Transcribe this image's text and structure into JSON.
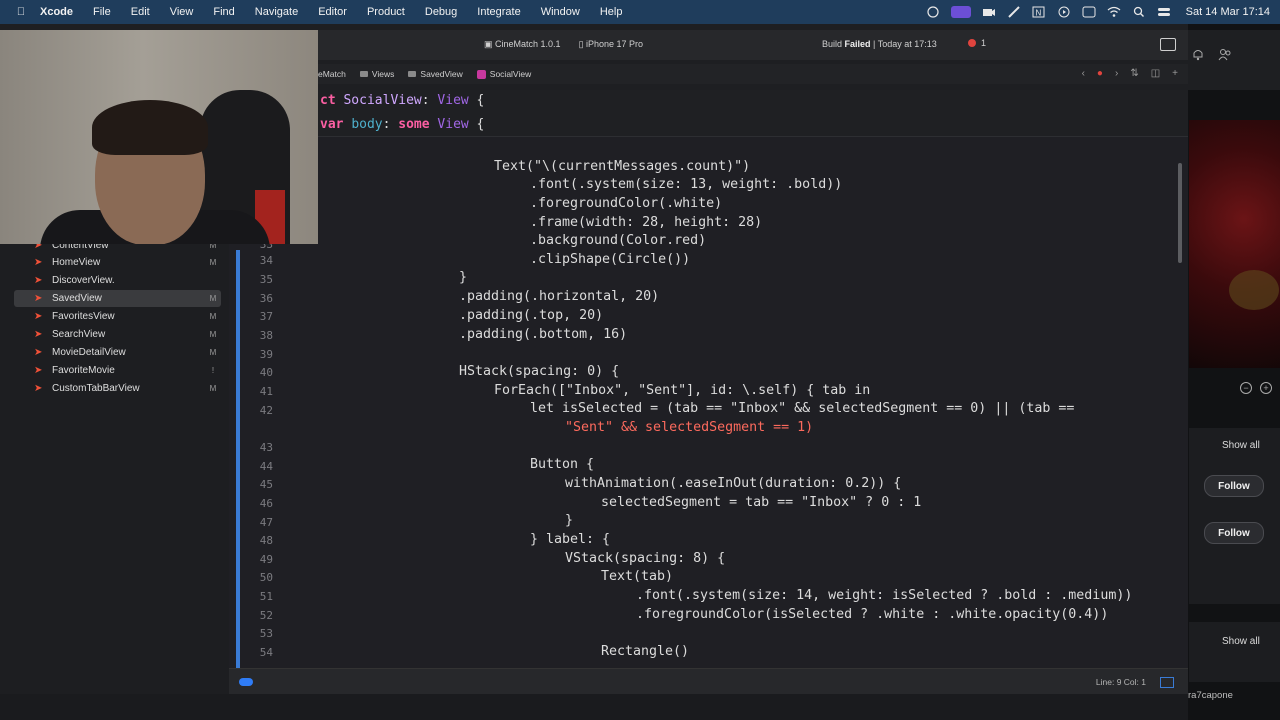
{
  "menubar": {
    "app_name": "Xcode",
    "items": [
      "File",
      "Edit",
      "View",
      "Find",
      "Navigate",
      "Editor",
      "Product",
      "Debug",
      "Integrate",
      "Window",
      "Help"
    ],
    "clock": "Sat 14 Mar 17:14"
  },
  "toolbar": {
    "scheme": "CineMatch 1.0.1",
    "separator": "›",
    "device": "iPhone 17 Pro",
    "build_prefix": "Build ",
    "build_status": "Failed",
    "build_time": " | Today at 17:13",
    "error_count": "1"
  },
  "jumpbar": {
    "crumbs": [
      "eMatch",
      "Views",
      "SavedView",
      "SocialView"
    ]
  },
  "sticky": {
    "line1": [
      "ct ",
      "SocialView",
      ": ",
      "View",
      " {"
    ],
    "line2": [
      "var ",
      "body",
      ": ",
      "some ",
      "View",
      " {"
    ]
  },
  "navigator": {
    "items": [
      {
        "label": "ContentView",
        "status": "M"
      },
      {
        "label": "HomeView",
        "status": "M"
      },
      {
        "label": "DiscoverView.",
        "status": ""
      },
      {
        "label": "SavedView",
        "status": "M"
      },
      {
        "label": "FavoritesView",
        "status": "M"
      },
      {
        "label": "SearchView",
        "status": "M"
      },
      {
        "label": "MovieDetailView",
        "status": "M"
      },
      {
        "label": "FavoriteMovie",
        "status": "!"
      },
      {
        "label": "CustomTabBarView",
        "status": "M"
      }
    ]
  },
  "editor": {
    "line_numbers": [
      "33",
      "34",
      "35",
      "36",
      "37",
      "38",
      "39",
      "40",
      "41",
      "42",
      "43",
      "44",
      "45",
      "46",
      "47",
      "48",
      "49",
      "50",
      "51",
      "52",
      "53",
      "54"
    ],
    "code": {
      "l0": "Text(\"\\(currentMessages.count)\")",
      "l1": ".font(.system(size: 13, weight: .bold))",
      "l2": ".foregroundColor(.white)",
      "l3": ".frame(width: 28, height: 28)",
      "l4": ".background(Color.red)",
      "l5": ".clipShape(Circle())",
      "l6": "}",
      "l7": ".padding(.horizontal, 20)",
      "l8": ".padding(.top, 20)",
      "l9": ".padding(.bottom, 16)",
      "l10": "HStack(spacing: 0) {",
      "l11": "ForEach([\"Inbox\", \"Sent\"], id: \\.self) { tab in",
      "l12": "let isSelected = (tab == \"Inbox\" && selectedSegment == 0) || (tab ==",
      "l13": "\"Sent\" && selectedSegment == 1)",
      "l14": "Button {",
      "l15": "withAnimation(.easeInOut(duration: 0.2)) {",
      "l16": "selectedSegment = tab == \"Inbox\" ? 0 : 1",
      "l17": "}",
      "l18": "} label: {",
      "l19": "VStack(spacing: 8) {",
      "l20": "Text(tab)",
      "l21": ".font(.system(size: 14, weight: isSelected ? .bold : .medium))",
      "l22": ".foregroundColor(isSelected ? .white : .white.opacity(0.4))",
      "l23": "Rectangle()"
    }
  },
  "statusbar": {
    "cursor": "Line: 9  Col: 1"
  },
  "rightwin": {
    "show_all_1": "Show all",
    "follow_1": "Follow",
    "follow_2": "Follow",
    "show_all_2": "Show all",
    "handle": "ra7capone"
  }
}
